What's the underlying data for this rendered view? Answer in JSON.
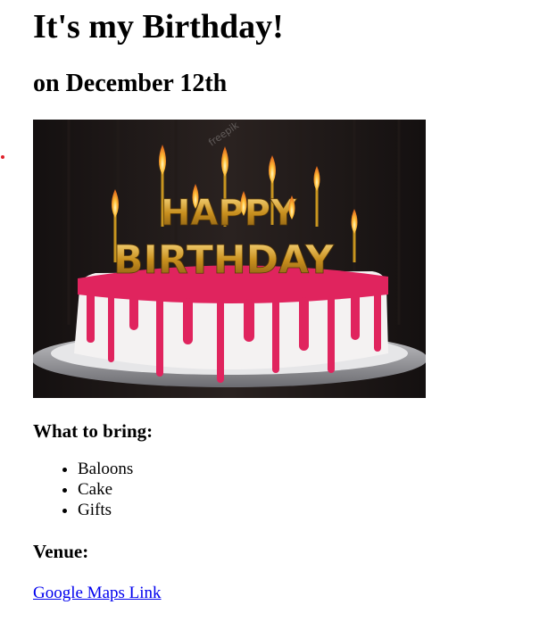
{
  "page": {
    "title": "It's my Birthday!",
    "subtitle": "on December 12th"
  },
  "image": {
    "cake_text_top": "HAPPY",
    "cake_text_bottom": "BIRTHDAY",
    "watermark": "freepik"
  },
  "bring": {
    "heading": "What to bring:",
    "items": [
      "Baloons",
      "Cake",
      "Gifts"
    ]
  },
  "venue": {
    "heading": "Venue:",
    "link_label": "Google Maps Link"
  },
  "colors": {
    "link": "#0000ee",
    "icing": "#e0245e",
    "background_dark": "#1c1715"
  }
}
